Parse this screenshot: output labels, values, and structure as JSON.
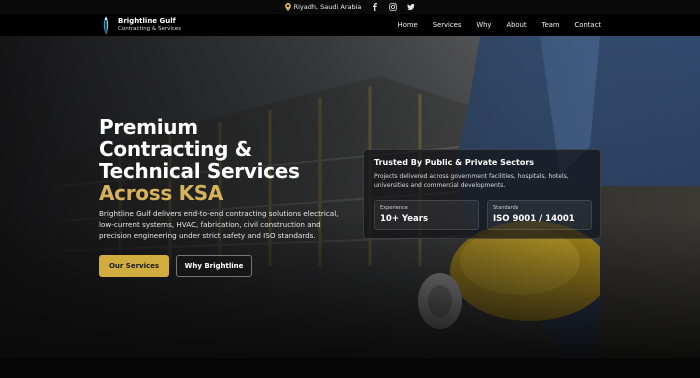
{
  "topbar": {
    "location": "Riyadh, Saudi Arabia",
    "social": [
      "facebook-icon",
      "instagram-icon",
      "twitter-icon"
    ]
  },
  "brand": {
    "name": "Brightline Gulf",
    "tagline": "Contracting & Services"
  },
  "nav": {
    "items": [
      "Home",
      "Services",
      "Why",
      "About",
      "Team",
      "Contact"
    ]
  },
  "hero": {
    "headline": [
      "Premium",
      "Contracting &",
      "Technical Services"
    ],
    "headline_accent": "Across KSA",
    "description": "Brightline Gulf delivers end-to-end contracting solutions electrical, low-current systems, HVAC, fabrication, civil construction and precision engineering under strict safety and ISO standards.",
    "primary_button": "Our Services",
    "secondary_button": "Why Brightline"
  },
  "trust_card": {
    "title": "Trusted By Public & Private Sectors",
    "text": "Projects delivered across government facilities, hospitals, hotels, universities and commercial developments.",
    "stats": [
      {
        "label": "Experience",
        "value": "10+ Years"
      },
      {
        "label": "Standards",
        "value": "ISO 9001 / 14001"
      }
    ]
  },
  "colors": {
    "accent": "#d6b25a",
    "button_primary": "#d0ad3e",
    "topbar_bg": "#0a0a0a",
    "nav_bg": "#000000"
  }
}
